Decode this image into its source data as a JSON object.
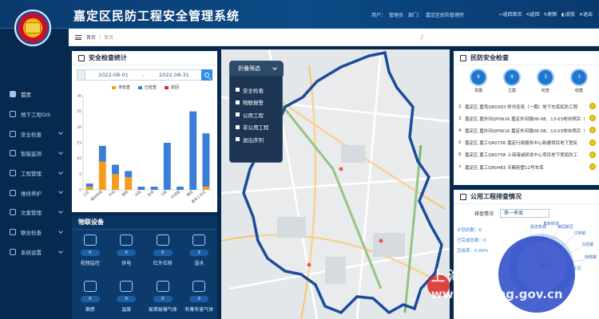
{
  "header": {
    "title": "嘉定区民防工程安全管理系统",
    "user_label": "用户：",
    "user_name": "管理员",
    "dept_label": "部门：",
    "dept_name": "嘉定区民防管理所",
    "actions": [
      "⇦返回首页",
      "⟲返回",
      "↻刷新",
      "◐皮肤",
      "✕退出"
    ]
  },
  "sidebar": {
    "items": [
      {
        "label": "首页",
        "active": true,
        "has_children": false,
        "icon": "home-icon"
      },
      {
        "label": "地下工程GIS",
        "active": false,
        "has_children": false,
        "icon": "map-icon"
      },
      {
        "label": "安全检查",
        "active": false,
        "has_children": true,
        "icon": "shield-icon"
      },
      {
        "label": "智能监测",
        "active": false,
        "has_children": true,
        "icon": "monitor-icon"
      },
      {
        "label": "工程管理",
        "active": false,
        "has_children": true,
        "icon": "document-icon"
      },
      {
        "label": "维修养护",
        "active": false,
        "has_children": true,
        "icon": "wrench-icon"
      },
      {
        "label": "文案管理",
        "active": false,
        "has_children": true,
        "icon": "file-icon"
      },
      {
        "label": "联合检查",
        "active": false,
        "has_children": true,
        "icon": "users-icon"
      },
      {
        "label": "系统设置",
        "active": false,
        "has_children": true,
        "icon": "gear-icon"
      }
    ]
  },
  "breadcrumb": {
    "home": "首页",
    "separator": "/",
    "current": "首页",
    "marker": "♪"
  },
  "safety_panel": {
    "title": "安全检查统计",
    "date_from": "2022-08-01",
    "date_dash": "-",
    "date_to": "2022-08-31"
  },
  "chart_data": {
    "type": "bar",
    "stacked": true,
    "categories": [
      "工区",
      "嘉定新城",
      "外冈",
      "南翔",
      "马陆",
      "安亭",
      "江桥",
      "外冈镇",
      "菊园",
      "嘉定工业区"
    ],
    "series": [
      {
        "name": "未检查",
        "color": "#f39c1f",
        "values": [
          1,
          9,
          5,
          4,
          0,
          0,
          0,
          0,
          0,
          1
        ]
      },
      {
        "name": "已检查",
        "color": "#3b7dd8",
        "values": [
          1,
          5,
          3,
          2,
          1,
          1,
          15,
          1,
          25,
          17
        ]
      },
      {
        "name": "驳回",
        "color": "#d62f2f",
        "values": [
          0,
          0,
          0,
          0,
          0,
          0,
          0,
          0,
          0,
          0
        ]
      }
    ],
    "ylim": [
      0,
      30
    ],
    "yticks": [
      0,
      5,
      10,
      15,
      20,
      25,
      30
    ],
    "grid": false,
    "legend": "top"
  },
  "iot_panel": {
    "title": "物联设备",
    "devices": [
      {
        "label": "视频监控",
        "count": "0",
        "icon": "camera-icon"
      },
      {
        "label": "供电",
        "count": "0",
        "icon": "power-icon"
      },
      {
        "label": "红外位移",
        "count": "0",
        "icon": "infrared-icon"
      },
      {
        "label": "湿水",
        "count": "3",
        "icon": "water-icon"
      },
      {
        "label": "烟感",
        "count": "0",
        "icon": "smoke-icon"
      },
      {
        "label": "温度",
        "count": "0",
        "icon": "thermometer-icon"
      },
      {
        "label": "易燃易爆气体",
        "count": "0",
        "icon": "flame-icon"
      },
      {
        "label": "有毒有害气体",
        "count": "0",
        "icon": "gas-icon"
      }
    ]
  },
  "map_filter": {
    "title": "折叠筛选",
    "items": [
      "安全检查",
      "物联报警",
      "公用工程",
      "非公用工程",
      "退出序列"
    ]
  },
  "defense_panel": {
    "title": "民防安全检查",
    "badges": [
      {
        "value": "9",
        "label": "发展"
      },
      {
        "value": "9",
        "label": "立案"
      },
      {
        "value": "3",
        "label": "检查"
      },
      {
        "value": "3",
        "label": "结案"
      }
    ],
    "tasks": [
      {
        "index": "2",
        "text": "嘉定区 嘉弯QR0393 终邻佳苑（一期）地下车库民防工程"
      },
      {
        "index": "3",
        "text": "嘉定区 嘉外冈QP0616 嘉定外冈镇08-08、13-03地块项目（"
      },
      {
        "index": "4",
        "text": "嘉定区 嘉外冈QP0616 嘉定外冈镇08-08、13-03地块项目（"
      },
      {
        "index": "5",
        "text": "嘉定区 嘉工QR0756 嘉定行政服务中心新建项目地下室民"
      },
      {
        "index": "6",
        "text": "嘉定区 嘉工QR0758 上海海诚研发中心项目地下室民防工"
      },
      {
        "index": "7",
        "text": "嘉定区 嘉工QR0483 天赐别墅12号车库"
      }
    ]
  },
  "public_panel": {
    "title": "公用工程排查情况",
    "filter_label": "排查情况",
    "filter_value": "第一季度",
    "stats": [
      "计划总数：6",
      "已完成总数：0",
      "完成率：0.00%"
    ],
    "donut_labels": [
      "嘉定新城",
      "真新街道",
      "菊园新区",
      "江桥镇",
      "马陆镇",
      "南翔镇",
      "工区"
    ]
  },
  "watermark": {
    "cn": "上海嘉定",
    "url": "www.jiading.gov.cn"
  }
}
